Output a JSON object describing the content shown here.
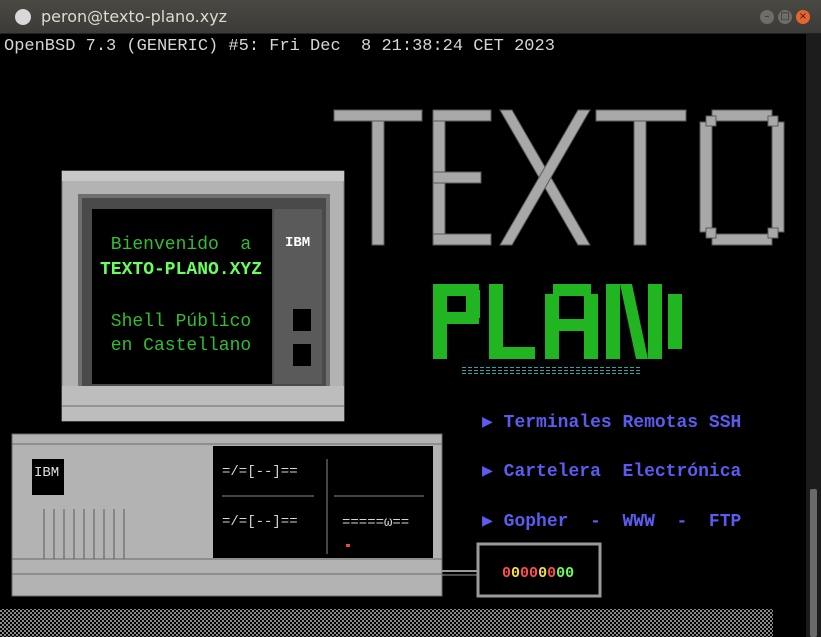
{
  "window": {
    "title": "peron@texto-plano.xyz",
    "controls": [
      "minimize-icon",
      "maximize-icon",
      "close-icon"
    ],
    "close_glyph": "×"
  },
  "terminal": {
    "banner": "OpenBSD 7.3 (GENERIC) #5: Fri Dec  8 21:38:24 CET 2023",
    "logo_line1": "TEXTO",
    "logo_line2": "PLANO",
    "monitor": {
      "greeting": "Bienvenido  a",
      "site": "TEXTO-PLANO.XYZ",
      "line3": "Shell Público",
      "line4": "en Castellano",
      "brand": "IBM"
    },
    "base": {
      "brand": "IBM",
      "slot1": "=/=[--]==",
      "slot2": "=/=[--]==",
      "slot3": "=====ω=="
    },
    "menu": [
      {
        "arrow": "▶",
        "label": "Terminales Remotas SSH"
      },
      {
        "arrow": "▶",
        "label": "Cartelera  Electrónica"
      },
      {
        "arrow": "▶",
        "label": "Gopher  -  WWW  -  FTP"
      }
    ],
    "modem_lights": "00000000"
  },
  "colors": {
    "background": "#000000",
    "grey": "#b5b5b5",
    "green": "#2fbf2f",
    "lime": "#6bff5b",
    "blue": "#5b5bf0",
    "teal": "#2aa8a8"
  }
}
